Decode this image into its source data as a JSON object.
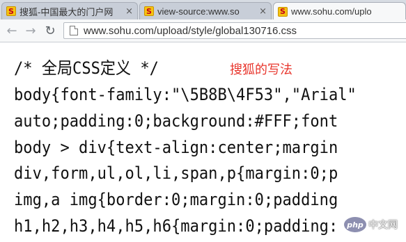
{
  "tabs": [
    {
      "title": "搜狐-中国最大的门户网",
      "favicon": "sohu-favicon",
      "close": "×",
      "active": false
    },
    {
      "title": "view-source:www.so",
      "favicon": "sohu-favicon",
      "close": "×",
      "active": false
    },
    {
      "title": "www.sohu.com/uplo",
      "favicon": "sohu-favicon",
      "close": "×",
      "active": true
    }
  ],
  "favicon_letter": "S",
  "toolbar": {
    "back_icon": "←",
    "forward_icon": "→",
    "reload_icon": "↻",
    "url": "www.sohu.com/upload/style/global130716.css"
  },
  "content": {
    "lines": [
      "/* 全局CSS定义 */",
      "body{font-family:\"\\5B8B\\4F53\",\"Arial\"",
      "auto;padding:0;background:#FFF;font",
      "body > div{text-align:center;margin",
      "div,form,ul,ol,li,span,p{margin:0;p",
      "img,a img{border:0;margin:0;padding",
      "h1,h2,h3,h4,h5,h6{margin:0;padding:"
    ],
    "annotation": "搜狐的写法"
  },
  "watermark": {
    "logo_text": "php",
    "text": "中文网"
  },
  "colors": {
    "annotation": "#e8352c",
    "favicon_bg": "#f6c311",
    "favicon_letter": "#c4001a"
  }
}
